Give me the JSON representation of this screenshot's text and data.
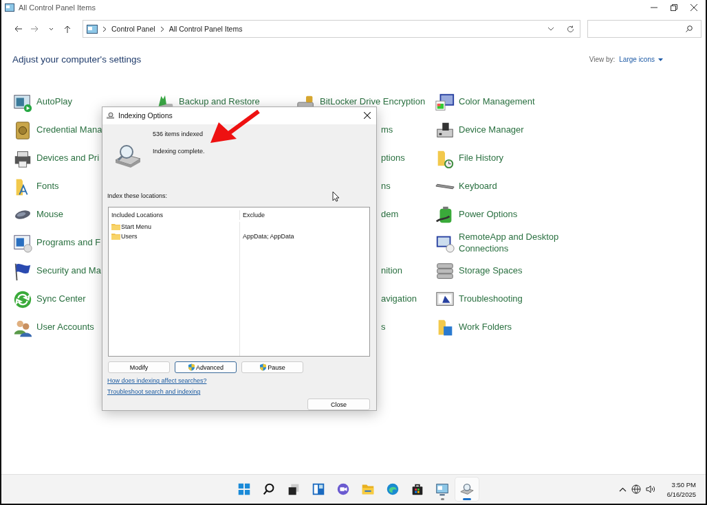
{
  "window": {
    "title": "All Control Panel Items"
  },
  "address_bar": {
    "breadcrumbs": [
      "Control Panel",
      "All Control Panel Items"
    ]
  },
  "heading": "Adjust your computer's settings",
  "view_by": {
    "label": "View by:",
    "value": "Large icons"
  },
  "columns": [
    [
      {
        "kind": "item",
        "label": "AutoPlay"
      },
      {
        "kind": "item",
        "label": "Credential Mana"
      },
      {
        "kind": "item",
        "label": "Devices and Pri"
      },
      {
        "kind": "item",
        "label": "Fonts"
      },
      {
        "kind": "item",
        "label": "Mouse"
      },
      {
        "kind": "item",
        "label": "Programs and F"
      },
      {
        "kind": "item",
        "label": "Security and Ma"
      },
      {
        "kind": "item",
        "label": "Sync Center"
      },
      {
        "kind": "item",
        "label": "User Accounts"
      }
    ],
    [
      {
        "kind": "item",
        "label": "Backup and Restore"
      }
    ],
    [
      {
        "kind": "item",
        "label": "BitLocker Drive Encryption"
      },
      {
        "kind": "fragment",
        "label": "ms"
      },
      {
        "kind": "fragment",
        "label": "ptions"
      },
      {
        "kind": "fragment",
        "label": "ns"
      },
      {
        "kind": "fragment",
        "label": "dem"
      },
      {
        "kind": "covered"
      },
      {
        "kind": "fragment",
        "label": "nition"
      },
      {
        "kind": "fragment",
        "label": "avigation"
      },
      {
        "kind": "fragment",
        "label": "s"
      }
    ],
    [
      {
        "kind": "item",
        "label": "Color Management"
      },
      {
        "kind": "item",
        "label": "Device Manager"
      },
      {
        "kind": "item",
        "label": "File History"
      },
      {
        "kind": "item",
        "label": "Keyboard"
      },
      {
        "kind": "item",
        "label": "Power Options"
      },
      {
        "kind": "item",
        "label": "RemoteApp and Desktop Connections"
      },
      {
        "kind": "item",
        "label": "Storage Spaces"
      },
      {
        "kind": "item",
        "label": "Troubleshooting"
      },
      {
        "kind": "item",
        "label": "Work Folders"
      }
    ]
  ],
  "dialog": {
    "title": "Indexing Options",
    "count": "536 items indexed",
    "status": "Indexing complete.",
    "section_label": "Index these locations:",
    "table": {
      "columns": [
        "Included Locations",
        "Exclude"
      ],
      "rows": [
        {
          "location": "Start Menu"
        },
        {
          "location": "Users",
          "exclude": "AppData; AppData"
        }
      ]
    },
    "buttons": [
      {
        "label": "Modify",
        "shield": false,
        "focused": false
      },
      {
        "label": "Advanced",
        "shield": true,
        "focused": true
      },
      {
        "label": "Pause",
        "shield": true,
        "focused": false
      }
    ],
    "links": [
      "How does indexing affect searches?",
      "Troubleshoot search and indexing"
    ],
    "close_button": "Close"
  },
  "taskbar": {
    "apps": [
      {
        "selected": false,
        "running": false
      },
      {
        "selected": false,
        "running": false
      },
      {
        "selected": false,
        "running": false
      },
      {
        "selected": false,
        "running": false
      },
      {
        "selected": false,
        "running": false
      },
      {
        "selected": false,
        "running": false
      },
      {
        "selected": false,
        "running": false
      },
      {
        "selected": false,
        "running": false
      },
      {
        "selected": false,
        "running": true
      },
      {
        "selected": true,
        "running": true
      }
    ],
    "time": "3:50 PM",
    "date": "6/16/2025"
  }
}
